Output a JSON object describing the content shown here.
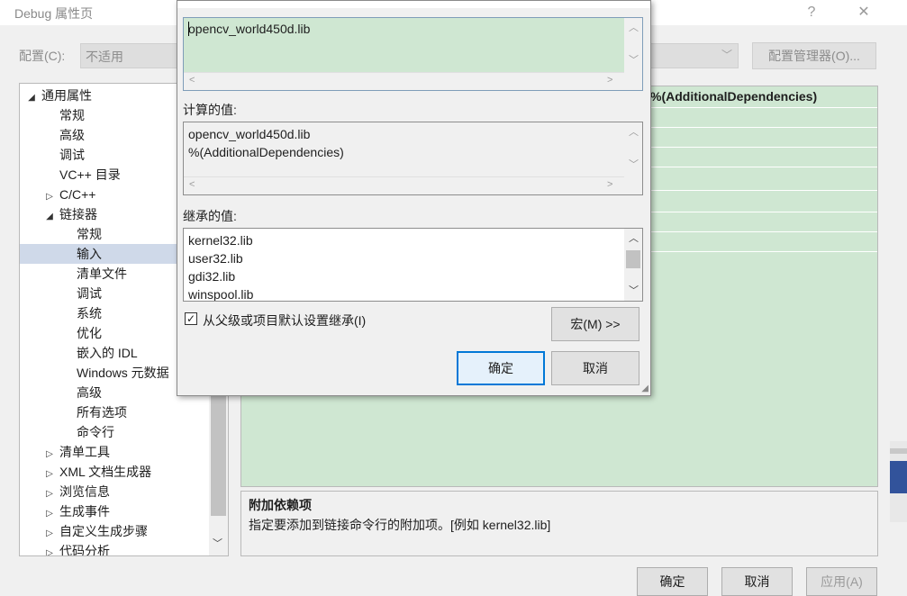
{
  "window": {
    "title": "Debug 属性页",
    "help_btn": "?",
    "close_btn": "✕"
  },
  "config": {
    "label": "配置(C):",
    "value": "不适用",
    "manager_btn": "配置管理器(O)..."
  },
  "tree": {
    "items": [
      {
        "label": "通用属性",
        "arrow": "◢",
        "depth": 0
      },
      {
        "label": "常规",
        "arrow": "",
        "depth": 1
      },
      {
        "label": "高级",
        "arrow": "",
        "depth": 1
      },
      {
        "label": "调试",
        "arrow": "",
        "depth": 1
      },
      {
        "label": "VC++ 目录",
        "arrow": "",
        "depth": 1
      },
      {
        "label": "C/C++",
        "arrow": "▷",
        "depth": 1
      },
      {
        "label": "链接器",
        "arrow": "◢",
        "depth": 1
      },
      {
        "label": "常规",
        "arrow": "",
        "depth": 2
      },
      {
        "label": "输入",
        "arrow": "",
        "depth": 2,
        "selected": true
      },
      {
        "label": "清单文件",
        "arrow": "",
        "depth": 2
      },
      {
        "label": "调试",
        "arrow": "",
        "depth": 2
      },
      {
        "label": "系统",
        "arrow": "",
        "depth": 2
      },
      {
        "label": "优化",
        "arrow": "",
        "depth": 2
      },
      {
        "label": "嵌入的 IDL",
        "arrow": "",
        "depth": 2
      },
      {
        "label": "Windows 元数据",
        "arrow": "",
        "depth": 2
      },
      {
        "label": "高级",
        "arrow": "",
        "depth": 2
      },
      {
        "label": "所有选项",
        "arrow": "",
        "depth": 2
      },
      {
        "label": "命令行",
        "arrow": "",
        "depth": 2
      },
      {
        "label": "清单工具",
        "arrow": "▷",
        "depth": 1
      },
      {
        "label": "XML 文档生成器",
        "arrow": "▷",
        "depth": 1
      },
      {
        "label": "浏览信息",
        "arrow": "▷",
        "depth": 1
      },
      {
        "label": "生成事件",
        "arrow": "▷",
        "depth": 1
      },
      {
        "label": "自定义生成步骤",
        "arrow": "▷",
        "depth": 1
      },
      {
        "label": "代码分析",
        "arrow": "▷",
        "depth": 1
      }
    ]
  },
  "grid": {
    "visible_value": "%(AdditionalDependencies)"
  },
  "description": {
    "title": "附加依赖项",
    "text": "指定要添加到链接命令行的附加项。[例如 kernel32.lib]"
  },
  "bottom_buttons": {
    "ok": "确定",
    "cancel": "取消",
    "apply": "应用(A)"
  },
  "dialog": {
    "edit_value": "opencv_world450d.lib",
    "computed_label": "计算的值:",
    "computed_lines": "opencv_world450d.lib\n%(AdditionalDependencies)",
    "inherited_label": "继承的值:",
    "inherited_lines": "kernel32.lib\nuser32.lib\ngdi32.lib\nwinspool.lib",
    "inherit_checkbox_label": "从父级或项目默认设置继承(I)",
    "inherit_checked": "✓",
    "macro_btn": "宏(M) >>",
    "ok_btn": "确定",
    "cancel_btn": "取消"
  },
  "colors": {
    "grid_bg": "#cfe7d2",
    "selection": "#cfd9e9",
    "primary_border": "#0078d7"
  }
}
